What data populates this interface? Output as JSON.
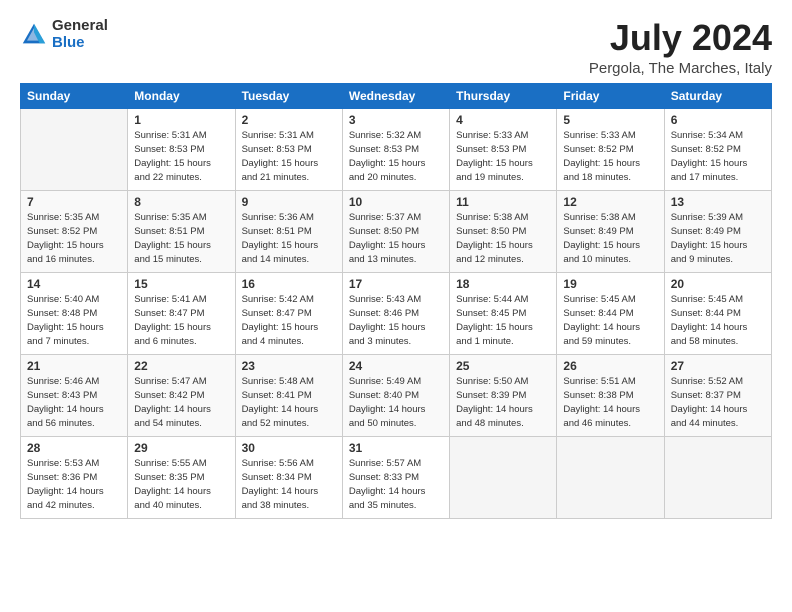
{
  "logo": {
    "general": "General",
    "blue": "Blue"
  },
  "title": "July 2024",
  "location": "Pergola, The Marches, Italy",
  "days_of_week": [
    "Sunday",
    "Monday",
    "Tuesday",
    "Wednesday",
    "Thursday",
    "Friday",
    "Saturday"
  ],
  "weeks": [
    [
      {
        "day": "",
        "info": ""
      },
      {
        "day": "1",
        "info": "Sunrise: 5:31 AM\nSunset: 8:53 PM\nDaylight: 15 hours\nand 22 minutes."
      },
      {
        "day": "2",
        "info": "Sunrise: 5:31 AM\nSunset: 8:53 PM\nDaylight: 15 hours\nand 21 minutes."
      },
      {
        "day": "3",
        "info": "Sunrise: 5:32 AM\nSunset: 8:53 PM\nDaylight: 15 hours\nand 20 minutes."
      },
      {
        "day": "4",
        "info": "Sunrise: 5:33 AM\nSunset: 8:53 PM\nDaylight: 15 hours\nand 19 minutes."
      },
      {
        "day": "5",
        "info": "Sunrise: 5:33 AM\nSunset: 8:52 PM\nDaylight: 15 hours\nand 18 minutes."
      },
      {
        "day": "6",
        "info": "Sunrise: 5:34 AM\nSunset: 8:52 PM\nDaylight: 15 hours\nand 17 minutes."
      }
    ],
    [
      {
        "day": "7",
        "info": "Sunrise: 5:35 AM\nSunset: 8:52 PM\nDaylight: 15 hours\nand 16 minutes."
      },
      {
        "day": "8",
        "info": "Sunrise: 5:35 AM\nSunset: 8:51 PM\nDaylight: 15 hours\nand 15 minutes."
      },
      {
        "day": "9",
        "info": "Sunrise: 5:36 AM\nSunset: 8:51 PM\nDaylight: 15 hours\nand 14 minutes."
      },
      {
        "day": "10",
        "info": "Sunrise: 5:37 AM\nSunset: 8:50 PM\nDaylight: 15 hours\nand 13 minutes."
      },
      {
        "day": "11",
        "info": "Sunrise: 5:38 AM\nSunset: 8:50 PM\nDaylight: 15 hours\nand 12 minutes."
      },
      {
        "day": "12",
        "info": "Sunrise: 5:38 AM\nSunset: 8:49 PM\nDaylight: 15 hours\nand 10 minutes."
      },
      {
        "day": "13",
        "info": "Sunrise: 5:39 AM\nSunset: 8:49 PM\nDaylight: 15 hours\nand 9 minutes."
      }
    ],
    [
      {
        "day": "14",
        "info": "Sunrise: 5:40 AM\nSunset: 8:48 PM\nDaylight: 15 hours\nand 7 minutes."
      },
      {
        "day": "15",
        "info": "Sunrise: 5:41 AM\nSunset: 8:47 PM\nDaylight: 15 hours\nand 6 minutes."
      },
      {
        "day": "16",
        "info": "Sunrise: 5:42 AM\nSunset: 8:47 PM\nDaylight: 15 hours\nand 4 minutes."
      },
      {
        "day": "17",
        "info": "Sunrise: 5:43 AM\nSunset: 8:46 PM\nDaylight: 15 hours\nand 3 minutes."
      },
      {
        "day": "18",
        "info": "Sunrise: 5:44 AM\nSunset: 8:45 PM\nDaylight: 15 hours\nand 1 minute."
      },
      {
        "day": "19",
        "info": "Sunrise: 5:45 AM\nSunset: 8:44 PM\nDaylight: 14 hours\nand 59 minutes."
      },
      {
        "day": "20",
        "info": "Sunrise: 5:45 AM\nSunset: 8:44 PM\nDaylight: 14 hours\nand 58 minutes."
      }
    ],
    [
      {
        "day": "21",
        "info": "Sunrise: 5:46 AM\nSunset: 8:43 PM\nDaylight: 14 hours\nand 56 minutes."
      },
      {
        "day": "22",
        "info": "Sunrise: 5:47 AM\nSunset: 8:42 PM\nDaylight: 14 hours\nand 54 minutes."
      },
      {
        "day": "23",
        "info": "Sunrise: 5:48 AM\nSunset: 8:41 PM\nDaylight: 14 hours\nand 52 minutes."
      },
      {
        "day": "24",
        "info": "Sunrise: 5:49 AM\nSunset: 8:40 PM\nDaylight: 14 hours\nand 50 minutes."
      },
      {
        "day": "25",
        "info": "Sunrise: 5:50 AM\nSunset: 8:39 PM\nDaylight: 14 hours\nand 48 minutes."
      },
      {
        "day": "26",
        "info": "Sunrise: 5:51 AM\nSunset: 8:38 PM\nDaylight: 14 hours\nand 46 minutes."
      },
      {
        "day": "27",
        "info": "Sunrise: 5:52 AM\nSunset: 8:37 PM\nDaylight: 14 hours\nand 44 minutes."
      }
    ],
    [
      {
        "day": "28",
        "info": "Sunrise: 5:53 AM\nSunset: 8:36 PM\nDaylight: 14 hours\nand 42 minutes."
      },
      {
        "day": "29",
        "info": "Sunrise: 5:55 AM\nSunset: 8:35 PM\nDaylight: 14 hours\nand 40 minutes."
      },
      {
        "day": "30",
        "info": "Sunrise: 5:56 AM\nSunset: 8:34 PM\nDaylight: 14 hours\nand 38 minutes."
      },
      {
        "day": "31",
        "info": "Sunrise: 5:57 AM\nSunset: 8:33 PM\nDaylight: 14 hours\nand 35 minutes."
      },
      {
        "day": "",
        "info": ""
      },
      {
        "day": "",
        "info": ""
      },
      {
        "day": "",
        "info": ""
      }
    ]
  ]
}
